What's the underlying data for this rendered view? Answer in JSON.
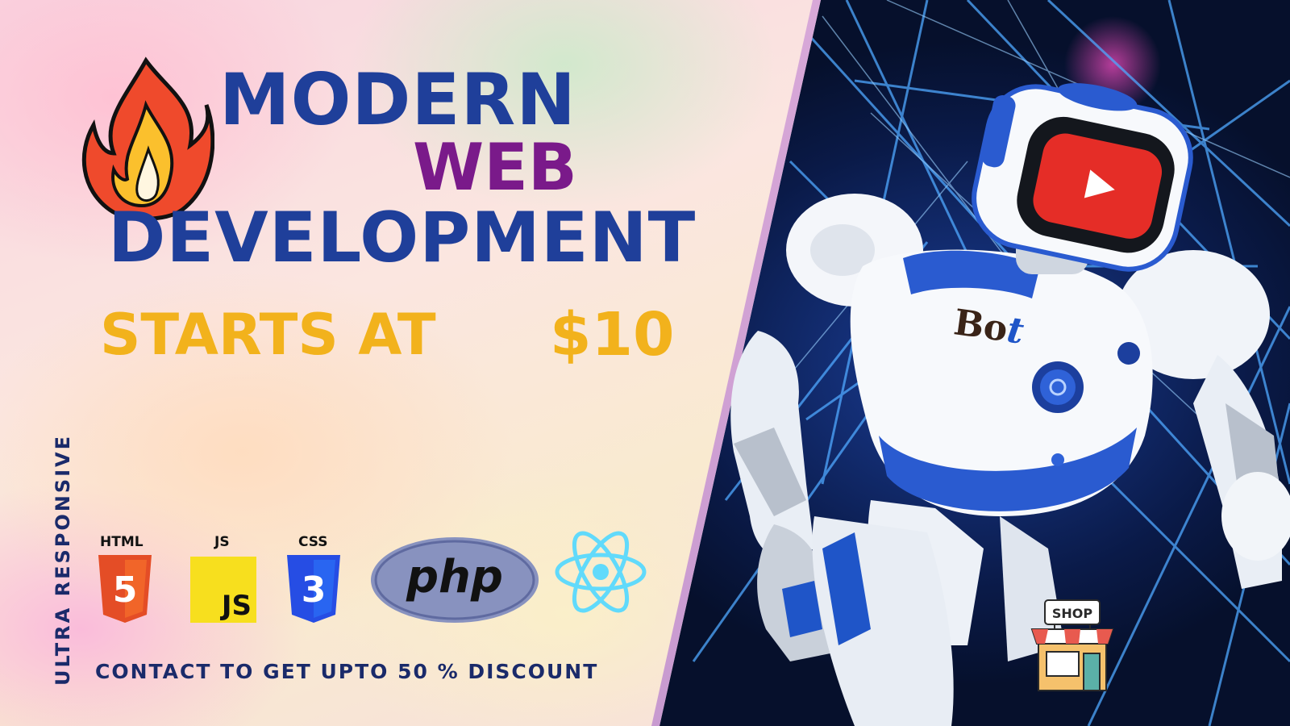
{
  "headline": {
    "line1": "MODERN",
    "line2": "WEB",
    "line3": "DEVELOPMENT",
    "line4_prefix": "STARTS AT",
    "line4_price": "$10"
  },
  "side_label": "ULTRA RESPONSIVE",
  "tech_badges": {
    "html_label": "HTML",
    "html_digit": "5",
    "js_label": "JS",
    "js_text": "JS",
    "css_label": "CSS",
    "css_digit": "3",
    "php_text": "php"
  },
  "contact_text": "CONTACT TO GET UPTO 50 % DISCOUNT",
  "robot_label": {
    "prefix": "Bo",
    "suffix": "t"
  },
  "shop_sign": "SHOP",
  "colors": {
    "navy": "#1f3f9a",
    "purple": "#7a1a8a",
    "gold": "#f2b21c",
    "youtube_red": "#e52d27",
    "html_orange": "#e44d26",
    "js_yellow": "#f7df1e",
    "css_blue": "#264de4",
    "php_purple": "#8892bf",
    "react_cyan": "#61dafb"
  },
  "icons": [
    "fire-icon",
    "html5-logo",
    "js-logo",
    "css3-logo",
    "php-logo",
    "react-logo",
    "youtube-play-icon",
    "shop-icon"
  ]
}
